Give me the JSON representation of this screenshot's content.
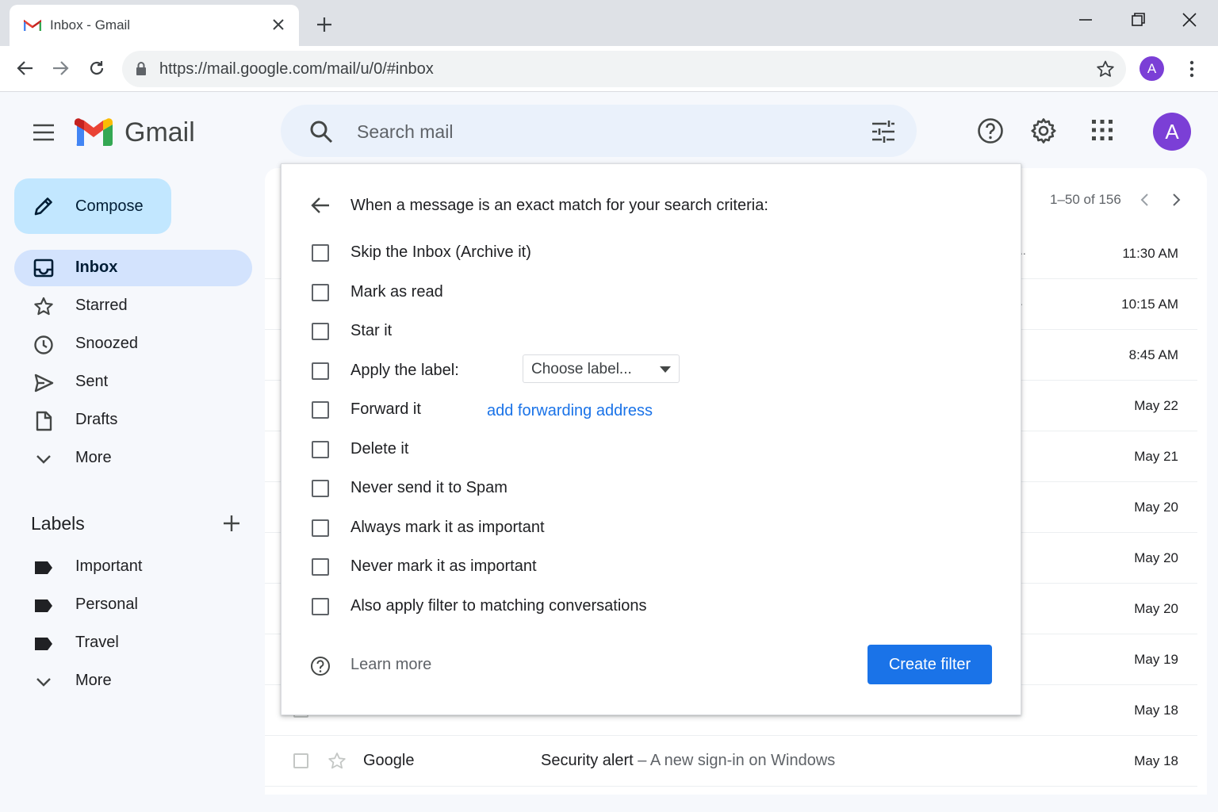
{
  "browser": {
    "tab_title": "Inbox - Gmail",
    "url": "https://mail.google.com/mail/u/0/#inbox",
    "profile_initial": "A"
  },
  "header": {
    "product_name": "Gmail",
    "search_placeholder": "Search mail",
    "account_initial": "A"
  },
  "sidebar": {
    "compose_label": "Compose",
    "items": [
      {
        "label": "Inbox",
        "icon": "inbox-icon",
        "active": true
      },
      {
        "label": "Starred",
        "icon": "star-icon"
      },
      {
        "label": "Snoozed",
        "icon": "clock-icon"
      },
      {
        "label": "Sent",
        "icon": "send-icon"
      },
      {
        "label": "Drafts",
        "icon": "draft-icon"
      },
      {
        "label": "More",
        "icon": "chevron-down-icon"
      }
    ],
    "labels_title": "Labels",
    "labels": [
      {
        "label": "Important",
        "icon": "label-icon"
      },
      {
        "label": "Personal",
        "icon": "label-icon"
      },
      {
        "label": "Travel",
        "icon": "label-icon"
      },
      {
        "label": "More",
        "icon": "chevron-down-icon"
      }
    ]
  },
  "mail_list": {
    "pagination": "1–50 of 156",
    "dates": [
      "11:30 AM",
      "10:15 AM",
      "8:45 AM",
      "May 22",
      "May 21",
      "May 20",
      "May 20",
      "May 20",
      "May 19",
      "May 18"
    ],
    "last_row": {
      "sender": "Google",
      "subject": "Security alert",
      "snippet": " – A new sign-in on Windows",
      "date": "May 18"
    }
  },
  "filter_dialog": {
    "heading": "When a message is an exact match for your search criteria:",
    "options": [
      "Skip the Inbox (Archive it)",
      "Mark as read",
      "Star it",
      "Apply the label:",
      "Forward it",
      "Delete it",
      "Never send it to Spam",
      "Always mark it as important",
      "Never mark it as important",
      "Also apply filter to matching conversations"
    ],
    "label_select_value": "Choose label...",
    "forward_link": "add forwarding address",
    "learn_more": "Learn more",
    "create_button": "Create filter"
  },
  "colors": {
    "accent_blue": "#1a73e8",
    "compose_bg": "#c2e7ff",
    "active_nav_bg": "#d3e3fd",
    "avatar_purple": "#7b3fd6"
  }
}
